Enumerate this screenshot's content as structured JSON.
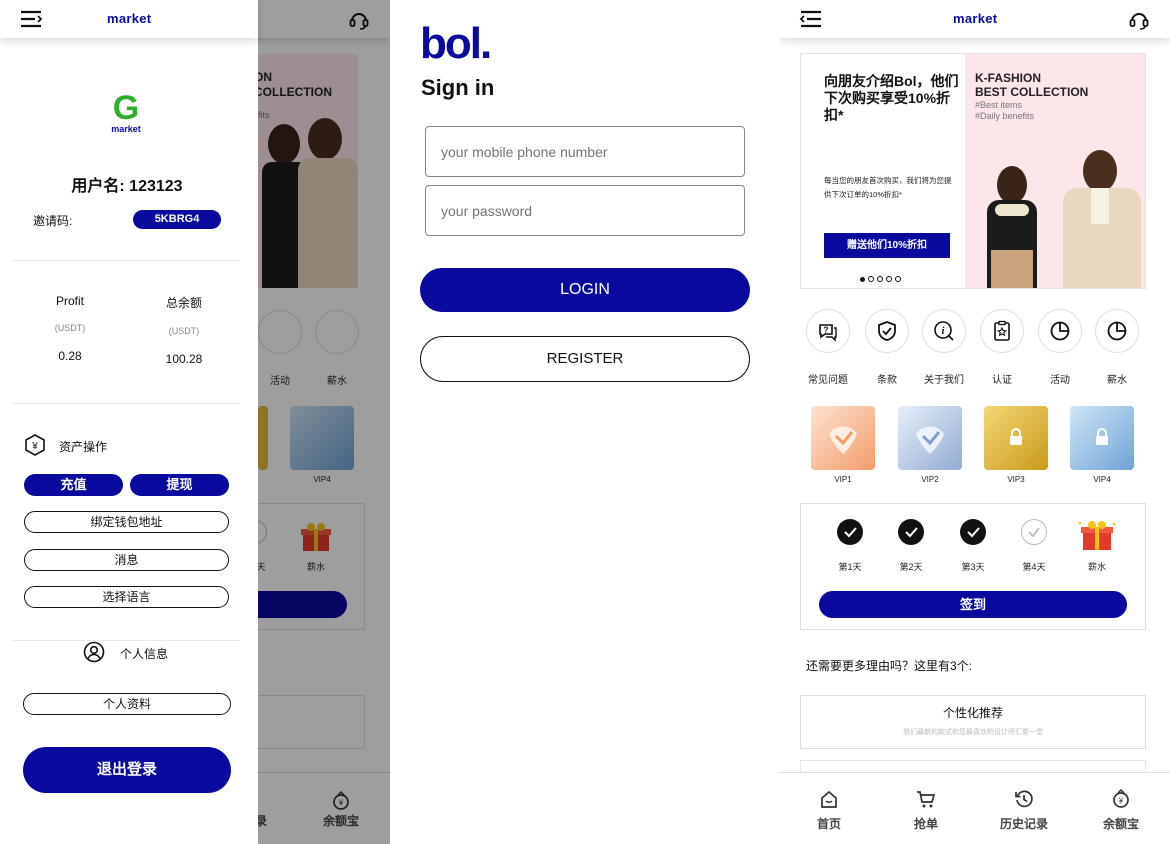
{
  "colors": {
    "accent": "#0a0a9e",
    "overlay": "rgba(0,0,0,0.38)",
    "bannerPink": "#fce6ea"
  },
  "drawer": {
    "app_logo": "market",
    "brand_letter": "G",
    "username": "用户名: 123123",
    "invite_label": "邀请码:",
    "invite_code": "5KBRG4",
    "stats": [
      {
        "label": "Profit",
        "unit": "(USDT)",
        "value": "0.28"
      },
      {
        "label": "总余额",
        "unit": "(USDT)",
        "value": "100.28"
      }
    ],
    "asset_section_title": "资产操作",
    "deposit_label": "充值",
    "withdraw_label": "提现",
    "bind_wallet_label": "绑定钱包地址",
    "messages_label": "消息",
    "language_label": "选择语言",
    "personal_info_title": "个人信息",
    "profile_label": "个人资料",
    "logout_label": "退出登录"
  },
  "bg_behind_drawer": {
    "banner_text": "ON\nCOLLECTION",
    "banner_sub": "fits",
    "icon_labels": [
      "活动",
      "薪水"
    ],
    "vip_label": "VIP4",
    "day_label": "天",
    "reward_label": "薪水",
    "tab_label": "录",
    "tab_last": "余额宝"
  },
  "login": {
    "brand": "bol.",
    "title": "Sign in",
    "phone_placeholder": "your mobile phone number",
    "password_placeholder": "your password",
    "login_label": "LOGIN",
    "register_label": "REGISTER"
  },
  "home": {
    "app_logo": "market",
    "banner": {
      "headline": "向朋友介绍Bol，他们下次购买享受10%折扣*",
      "body": "每当您的朋友首次购买，我们将为您提供下次订单的10%折扣*",
      "cta": "赠送他们10%折扣",
      "fashion_title": "K-FASHION\nBEST COLLECTION",
      "tags": "#Best items\n#Daily benefits"
    },
    "icons": [
      {
        "label": "常见问题",
        "icon": "faq-icon"
      },
      {
        "label": "条款",
        "icon": "shield-check-icon"
      },
      {
        "label": "关于我们",
        "icon": "info-icon"
      },
      {
        "label": "认证",
        "icon": "certificate-icon"
      },
      {
        "label": "活动",
        "icon": "pie-chart-icon"
      },
      {
        "label": "薪水",
        "icon": "pie-chart-icon"
      }
    ],
    "vips": [
      "VIP1",
      "VIP2",
      "VIP3",
      "VIP4"
    ],
    "days": [
      {
        "label": "第1天",
        "checked": true
      },
      {
        "label": "第2天",
        "checked": true
      },
      {
        "label": "第3天",
        "checked": true
      },
      {
        "label": "第4天",
        "checked": false
      }
    ],
    "reward_label": "薪水",
    "checkin_label": "签到",
    "reasons_title": "还需要更多理由吗？这里有3个:",
    "reason_card_title": "个性化推荐",
    "reason_card_desc": "我们最新的款式和您最喜欢的设计师汇聚一堂"
  },
  "tabbar": [
    {
      "label": "首页",
      "icon": "home-icon"
    },
    {
      "label": "抢单",
      "icon": "cart-icon"
    },
    {
      "label": "历史记录",
      "icon": "history-icon"
    },
    {
      "label": "余额宝",
      "icon": "piggy-bank-icon"
    }
  ]
}
